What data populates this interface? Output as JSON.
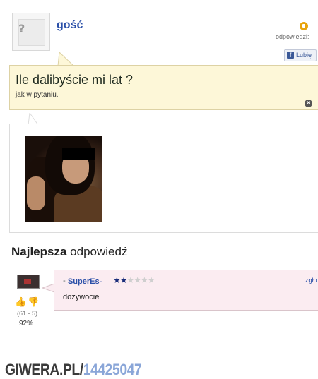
{
  "question": {
    "author": "gość",
    "answers_label": "odpowiedzi:",
    "like_label": "Lubię",
    "title": "Ile dalibyście mi lat ?",
    "subtitle": "jak w pytaniu."
  },
  "best_answer": {
    "heading_bold": "Najlepsza",
    "heading_rest": "odpowiedź",
    "author": "SuperEs-",
    "stars": "★★",
    "stars_empty": "★★★★",
    "link": "zgło",
    "text": "dożywocie",
    "votes": "(61 - 5)",
    "percent": "92%"
  },
  "watermark": {
    "brand": "GIWERA.PL/",
    "id": "14425047"
  },
  "icons": {
    "avatar": "anonymous-avatar-icon",
    "answers": "answers-count-icon",
    "close": "close-icon",
    "thumb_up": "thumb-up-icon",
    "thumb_down": "thumb-down-icon"
  }
}
